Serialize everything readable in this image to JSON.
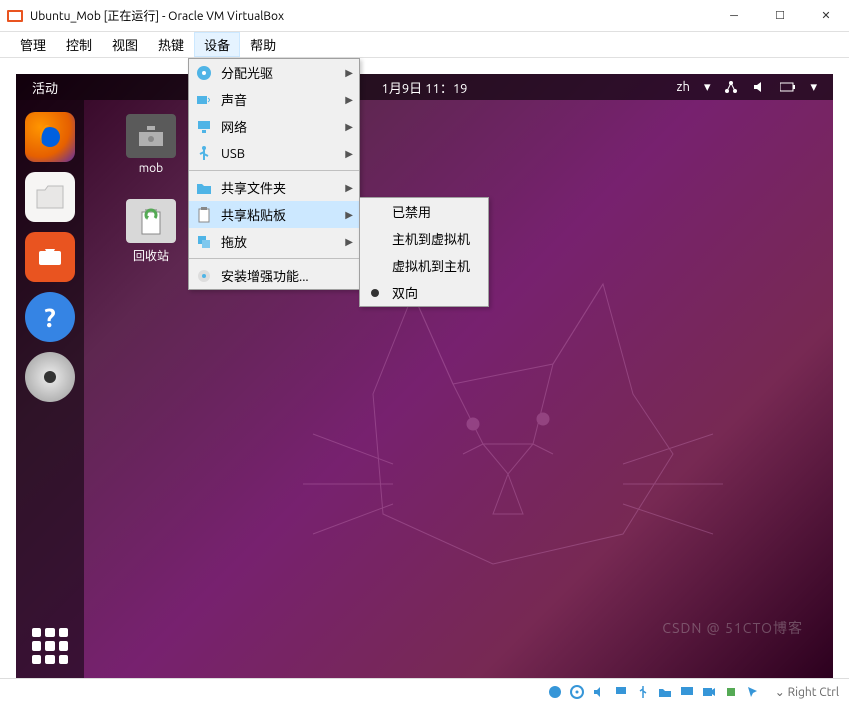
{
  "titlebar": {
    "text": "Ubuntu_Mob [正在运行] - Oracle VM VirtualBox"
  },
  "menubar": {
    "items": [
      "管理",
      "控制",
      "视图",
      "热键",
      "设备",
      "帮助"
    ],
    "activeIndex": 4
  },
  "devicesMenu": {
    "items": [
      {
        "icon": "disc",
        "label": "分配光驱",
        "arrow": true
      },
      {
        "icon": "audio",
        "label": "声音",
        "arrow": true
      },
      {
        "icon": "network",
        "label": "网络",
        "arrow": true
      },
      {
        "icon": "usb",
        "label": "USB",
        "arrow": true
      },
      {
        "sep": true
      },
      {
        "icon": "folder",
        "label": "共享文件夹",
        "arrow": true
      },
      {
        "icon": "clipboard",
        "label": "共享粘贴板",
        "arrow": true,
        "highlighted": true
      },
      {
        "icon": "drag",
        "label": "拖放",
        "arrow": true
      },
      {
        "sep": true
      },
      {
        "icon": "install",
        "label": "安装增强功能..."
      }
    ]
  },
  "clipboardSubmenu": {
    "items": [
      {
        "label": "已禁用"
      },
      {
        "label": "主机到虚拟机"
      },
      {
        "label": "虚拟机到主机"
      },
      {
        "label": "双向",
        "selected": true
      }
    ]
  },
  "ubuntu": {
    "activities": "活动",
    "datetime": "1月9日  11：19",
    "lang": "zh",
    "desktopIcons": {
      "folder": "mob",
      "trash": "回收站"
    }
  },
  "statusbar": {
    "captureKey": "Right Ctrl"
  },
  "watermark": "CSDN @ 51CTO博客"
}
